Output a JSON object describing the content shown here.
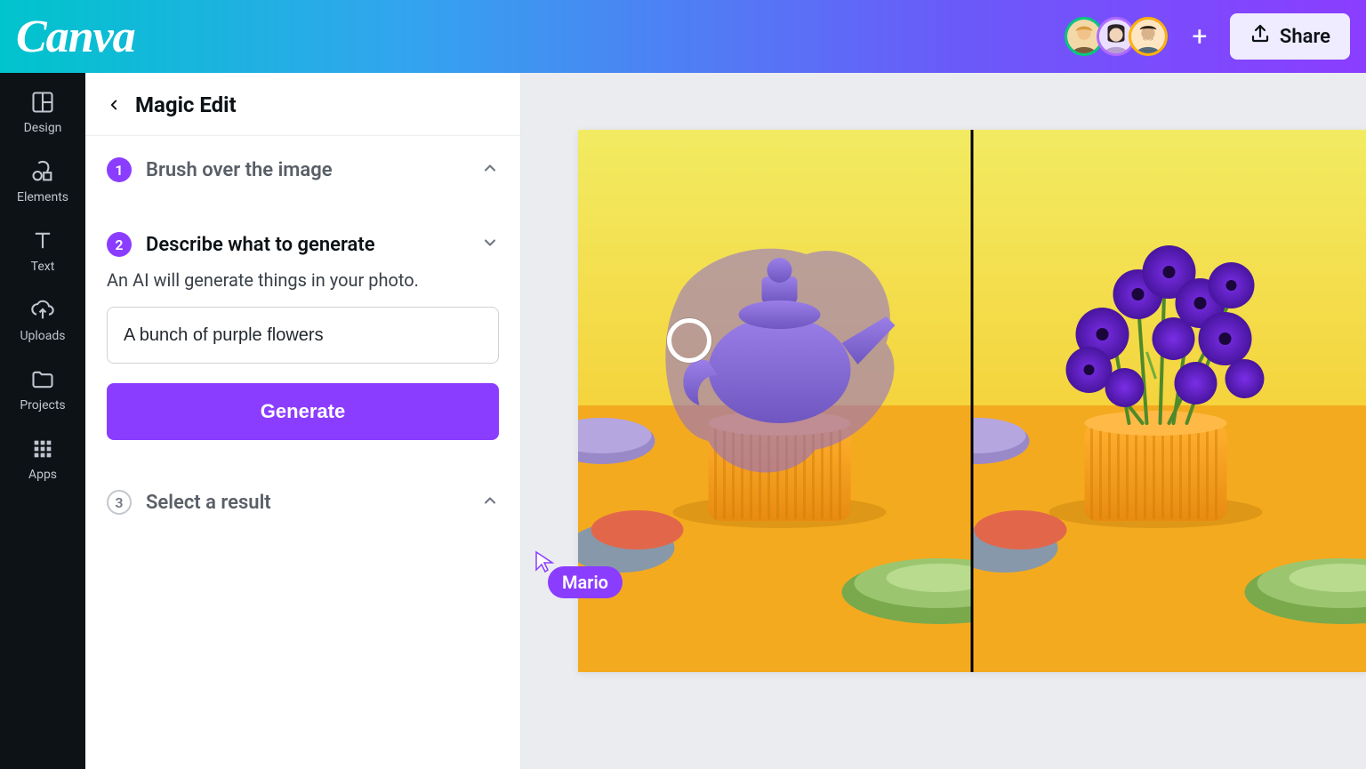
{
  "header": {
    "logo_text": "Canva",
    "share_label": "Share",
    "add_user_plus": "+"
  },
  "leftnav": {
    "items": [
      {
        "label": "Design"
      },
      {
        "label": "Elements"
      },
      {
        "label": "Text"
      },
      {
        "label": "Uploads"
      },
      {
        "label": "Projects"
      },
      {
        "label": "Apps"
      }
    ]
  },
  "panel": {
    "title": "Magic Edit",
    "steps": [
      {
        "num": "1",
        "title": "Brush over the image",
        "completed": true,
        "expanded": false
      },
      {
        "num": "2",
        "title": "Describe what to generate",
        "completed": true,
        "expanded": true
      },
      {
        "num": "3",
        "title": "Select a result",
        "completed": false,
        "expanded": false
      }
    ],
    "describe_help": "An AI will generate things in your photo.",
    "describe_input": "A bunch of purple flowers",
    "generate_label": "Generate"
  },
  "presence": {
    "cursor_user": "Mario"
  },
  "canvas": {
    "left_alt": "Yellow tabletop scene with orange ribbed vase; a purple teapot is selected with a brush mask overlay.",
    "right_alt": "Same yellow scene with purple flowers generated in the vase replacing the teapot."
  },
  "colors": {
    "accent": "#8b3dff",
    "teal": "#00c4cc"
  }
}
